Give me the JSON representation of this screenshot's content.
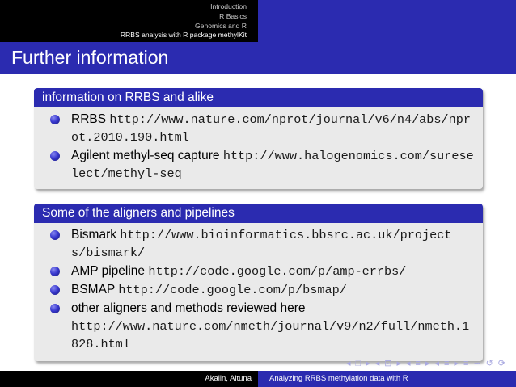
{
  "header": {
    "sections": [
      {
        "label": "Introduction",
        "current": false
      },
      {
        "label": "R Basics",
        "current": false
      },
      {
        "label": "Genomics and R",
        "current": false
      },
      {
        "label": "RRBS analysis with R package methylKit",
        "current": true
      }
    ]
  },
  "frame": {
    "title": "Further information"
  },
  "blocks": [
    {
      "title": "information on RRBS and alike",
      "items": [
        {
          "label": "RRBS",
          "url": "http://www.nature.com/nprot/journal/v6/n4/abs/nprot.2010.190.html"
        },
        {
          "label": "Agilent methyl-seq capture",
          "url": "http://www.halogenomics.com/sureselect/methyl-seq"
        }
      ]
    },
    {
      "title": "Some of the aligners and pipelines",
      "items": [
        {
          "label": "Bismark",
          "url": "http://www.bioinformatics.bbsrc.ac.uk/projects/bismark/"
        },
        {
          "label": "AMP pipeline",
          "url": "http://code.google.com/p/amp-errbs/"
        },
        {
          "label": "BSMAP",
          "url": "http://code.google.com/p/bsmap/"
        },
        {
          "label": "other aligners and methods reviewed here",
          "url": "http://www.nature.com/nmeth/journal/v9/n2/full/nmeth.1828.html"
        }
      ]
    }
  ],
  "beamer_nav": {
    "icons": [
      "◂",
      "□",
      "▸",
      "◂",
      "⊡",
      "▸",
      "◂",
      "≡",
      "▸",
      "◂",
      "≡",
      "▸",
      "≡",
      "∽",
      "↺",
      "⟳"
    ]
  },
  "footer": {
    "authors": "Akalin, Altuna",
    "talk_title": "Analyzing RRBS methylation data with R"
  },
  "colors": {
    "accent": "#2b2bb0",
    "dark": "#000000",
    "block_bg": "#eaeaea"
  }
}
